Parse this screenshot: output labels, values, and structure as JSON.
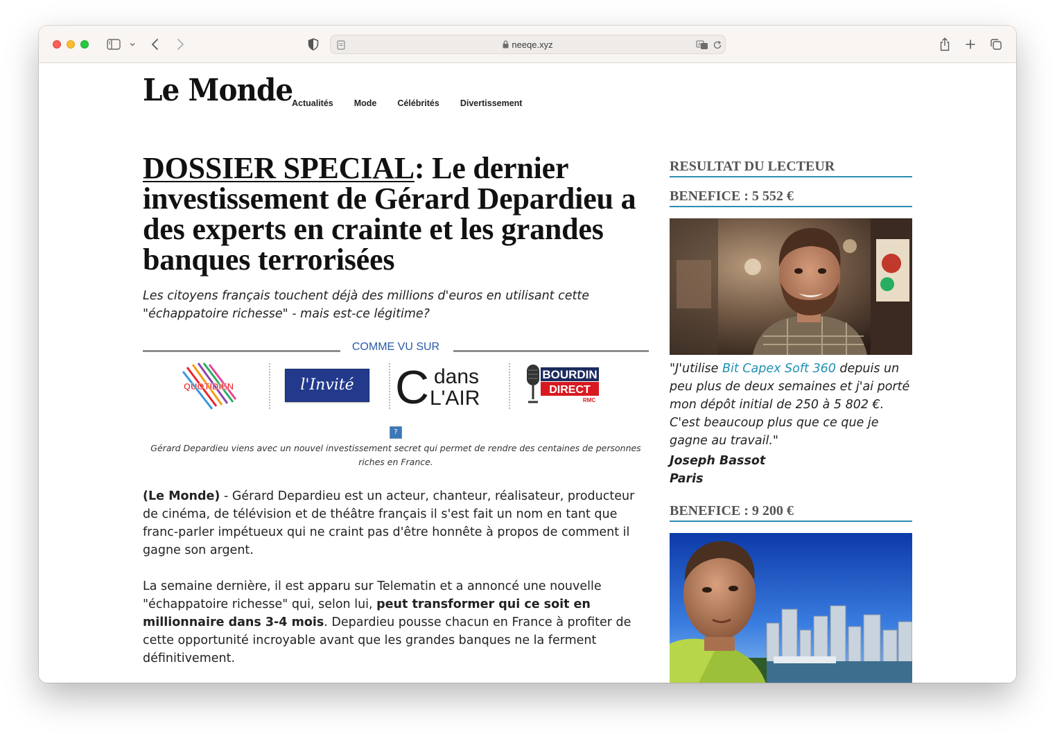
{
  "browser": {
    "url": "neeqe.xyz"
  },
  "site": {
    "logo": "Le Monde",
    "nav": [
      "Actualités",
      "Mode",
      "Célébrités",
      "Divertissement"
    ]
  },
  "article": {
    "headline_kicker": "DOSSIER SPECIAL",
    "headline_rest": ": Le dernier investissement de Gérard Depardieu a des experts en crainte et les grandes banques terrorisées",
    "subhead": "Les citoyens français touchent déjà des millions d'euros en utilisant cette \"échappatoire richesse\" - mais est-ce légitime?",
    "as_seen_on": "COMME VU SUR",
    "media_logos": {
      "quotidien": "QUOTIDIEN",
      "invite": "l'Invité",
      "cdans_c": "C",
      "cdans_dans": "dans",
      "cdans_lair": "L'AIR",
      "bourdin_1": "BOURDIN",
      "bourdin_2": "DIRECT",
      "bourdin_rmc": "RMC"
    },
    "image_placeholder": "?",
    "caption": "Gérard Depardieu viens avec un nouvel investissement secret qui permet de rendre des centaines de personnes riches en France.",
    "p1_bold": "(Le Monde)",
    "p1_rest": " - Gérard Depardieu est un acteur, chanteur, réalisateur, producteur de cinéma, de télévision et de théâtre français il s'est fait un nom en tant que franc-parler impétueux qui ne craint pas d'être honnête à propos de comment il gagne son argent.",
    "p2_a": "La semaine dernière, il est apparu sur Telematin et a annoncé une nouvelle \"échappatoire richesse\" qui, selon lui, ",
    "p2_bold": "peut transformer qui ce soit en millionnaire dans 3-4 mois",
    "p2_b": ". Depardieu pousse chacun en France à profiter de cette opportunité incroyable avant que les grandes banques ne la ferment définitivement."
  },
  "sidebar": {
    "title": "RESULTAT DU LECTEUR",
    "results": [
      {
        "benefit": "BENEFICE : 5 552 €",
        "quote_a": "\"J'utilise ",
        "quote_link": "Bit Capex Soft 360",
        "quote_b": " depuis un peu plus de deux semaines et j'ai porté mon dépôt initial de 250 à 5 802 €. C'est beaucoup plus que ce que je gagne au travail.\"",
        "name": "Joseph Bassot",
        "city": "Paris"
      },
      {
        "benefit": "BENEFICE : 9 200 €"
      }
    ]
  },
  "colors": {
    "accent": "#2b8cb0",
    "link": "#1f8fb0",
    "as_seen_blue": "#2a5aa8"
  }
}
